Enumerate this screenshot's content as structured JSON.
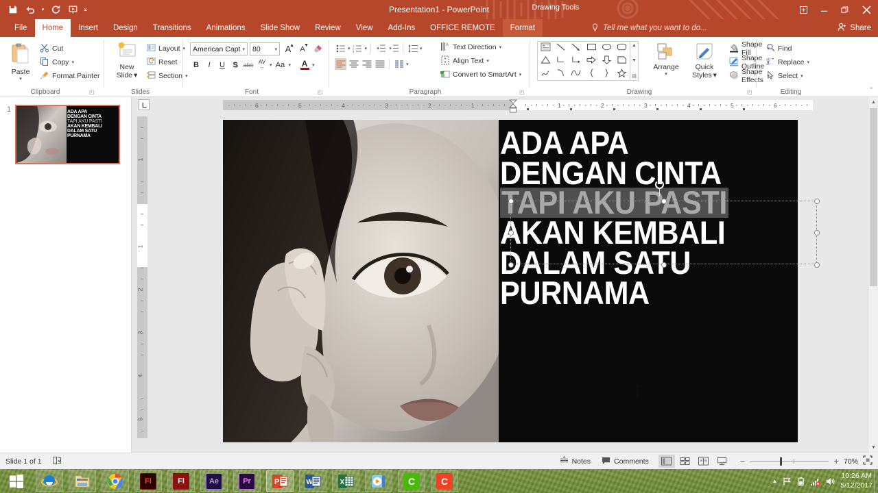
{
  "window": {
    "title": "Presentation1 - PowerPoint",
    "contextual_tools_label": "Drawing Tools",
    "quick_access": [
      {
        "name": "save-icon",
        "glyph": "💾"
      },
      {
        "name": "undo-icon",
        "glyph": "↶"
      },
      {
        "name": "redo-icon",
        "glyph": "↻"
      },
      {
        "name": "start-from-beginning-icon",
        "glyph": "▶"
      },
      {
        "name": "customize-quick-access-toolbar-icon",
        "glyph": "≡"
      }
    ],
    "controls": {
      "ribbon_display_options": "⊕",
      "minimize": "–",
      "restore": "❐",
      "close": "✕"
    }
  },
  "ribbon": {
    "tabs": [
      {
        "label": "File",
        "active": false
      },
      {
        "label": "Home",
        "active": true
      },
      {
        "label": "Insert",
        "active": false
      },
      {
        "label": "Design",
        "active": false
      },
      {
        "label": "Transitions",
        "active": false
      },
      {
        "label": "Animations",
        "active": false
      },
      {
        "label": "Slide Show",
        "active": false
      },
      {
        "label": "Review",
        "active": false
      },
      {
        "label": "View",
        "active": false
      },
      {
        "label": "Add-Ins",
        "active": false
      },
      {
        "label": "OFFICE REMOTE",
        "active": false
      }
    ],
    "contextual_tab": "Format",
    "tell_me_placeholder": "Tell me what you want to do...",
    "share_label": "Share",
    "groups": {
      "clipboard": {
        "label": "Clipboard",
        "paste": "Paste",
        "cut": "Cut",
        "copy": "Copy",
        "format_painter": "Format Painter"
      },
      "slides": {
        "label": "Slides",
        "new_slide_line1": "New",
        "new_slide_line2": "Slide",
        "layout": "Layout",
        "reset": "Reset",
        "section": "Section"
      },
      "font": {
        "label": "Font",
        "font_name": "American Capt",
        "font_size": "80",
        "bold": "B",
        "italic": "I",
        "underline": "U",
        "shadow": "S",
        "strikethrough": "abc",
        "character_spacing": "AV",
        "change_case": "Aa",
        "font_color": "A",
        "increase_font": "A",
        "decrease_font": "A",
        "clear_formatting": "⌫"
      },
      "paragraph": {
        "label": "Paragraph",
        "text_direction": "Text Direction",
        "align_text": "Align Text",
        "convert_to_smartart": "Convert to SmartArt"
      },
      "drawing": {
        "label": "Drawing",
        "arrange": "Arrange",
        "quick_styles_line1": "Quick",
        "quick_styles_line2": "Styles",
        "shape_fill": "Shape Fill",
        "shape_outline": "Shape Outline",
        "shape_effects": "Shape Effects"
      },
      "editing": {
        "label": "Editing",
        "find": "Find",
        "replace": "Replace",
        "select": "Select"
      }
    }
  },
  "slide_panel": {
    "slide_number": "1"
  },
  "slide": {
    "lines": [
      {
        "text": "ADA APA",
        "selected": false
      },
      {
        "text": "DENGAN CINTA",
        "selected": false
      },
      {
        "text": "TAPI AKU PASTI",
        "selected": true
      },
      {
        "text": "AKAN KEMBALI",
        "selected": false
      },
      {
        "text": "DALAM SATU",
        "selected": false
      },
      {
        "text": "PURNAMA",
        "selected": false
      }
    ]
  },
  "rulers": {
    "horizontal_left": [
      "6",
      "5",
      "4",
      "3",
      "2",
      "1"
    ],
    "horizontal_right": [
      "1",
      "2",
      "3",
      "4",
      "5",
      "6"
    ],
    "vertical_top": [
      "1"
    ],
    "vertical_bottom": [
      "1",
      "2",
      "3",
      "4",
      "5"
    ]
  },
  "status_bar": {
    "slide_count": "Slide 1 of 1",
    "accessibility_icon": "accessibility-check-icon",
    "notes": "Notes",
    "comments": "Comments",
    "views": [
      {
        "name": "normal-view",
        "selected": true
      },
      {
        "name": "slide-sorter-view",
        "selected": false
      },
      {
        "name": "reading-view",
        "selected": false
      },
      {
        "name": "slide-show-view",
        "selected": false
      }
    ],
    "zoom_out": "−",
    "zoom_in": "+",
    "zoom_level": "70%",
    "fit_to_window": "fit-slide-to-window-icon"
  },
  "taskbar": {
    "start": "windows-start-icon",
    "items": [
      {
        "name": "internet-explorer",
        "glyph": "e",
        "bg": "transparent",
        "fg": "#1a7fd4",
        "state": "pinned"
      },
      {
        "name": "file-explorer",
        "glyph": "🗀",
        "bg": "transparent",
        "fg": "#f0c36d",
        "state": "pinned"
      },
      {
        "name": "google-chrome",
        "glyph": "◉",
        "bg": "transparent",
        "fg": "#4285f4",
        "state": "pinned"
      },
      {
        "name": "adobe-flash-1",
        "glyph": "Fl",
        "bg": "#2b0000",
        "fg": "#e8453c",
        "state": "pinned"
      },
      {
        "name": "adobe-flash-2",
        "glyph": "Fl",
        "bg": "#8c1111",
        "fg": "#ffffff",
        "state": "pinned"
      },
      {
        "name": "adobe-after-effects",
        "glyph": "Ae",
        "bg": "#1f1040",
        "fg": "#b39ddb",
        "state": "pinned"
      },
      {
        "name": "adobe-premiere-pro",
        "glyph": "Pr",
        "bg": "#2a0b3d",
        "fg": "#ea80fc",
        "state": "pinned"
      },
      {
        "name": "microsoft-powerpoint",
        "glyph": "P",
        "bg": "#d24726",
        "fg": "#ffffff",
        "state": "active"
      },
      {
        "name": "microsoft-word",
        "glyph": "W",
        "bg": "#2b579a",
        "fg": "#ffffff",
        "state": "pinned"
      },
      {
        "name": "microsoft-excel",
        "glyph": "X",
        "bg": "#217346",
        "fg": "#ffffff",
        "state": "pinned"
      },
      {
        "name": "media-player",
        "glyph": "▶",
        "bg": "#6ab6e8",
        "fg": "#ff8c00",
        "state": "pinned"
      },
      {
        "name": "camtasia-studio",
        "glyph": "C",
        "bg": "#49b80d",
        "fg": "#ffffff",
        "state": "pinned"
      },
      {
        "name": "camtasia-recorder",
        "glyph": "C",
        "bg": "#ef4123",
        "fg": "#ffffff",
        "state": "pinned"
      }
    ],
    "tray": [
      {
        "name": "show-hidden-icons-icon",
        "glyph": "▲"
      },
      {
        "name": "action-center-flag-icon",
        "glyph": "⚑"
      },
      {
        "name": "battery-icon",
        "glyph": "▮"
      },
      {
        "name": "network-icon",
        "glyph": "◢"
      },
      {
        "name": "volume-icon",
        "glyph": "🔊"
      }
    ],
    "clock_time": "10:26 AM",
    "clock_date": "5/12/2017"
  },
  "colors": {
    "brand": "#b7472a",
    "accent_tab_active": "#ffffff",
    "thumbnail_selection": "#e1705a",
    "taskbar": "#7a9442"
  }
}
